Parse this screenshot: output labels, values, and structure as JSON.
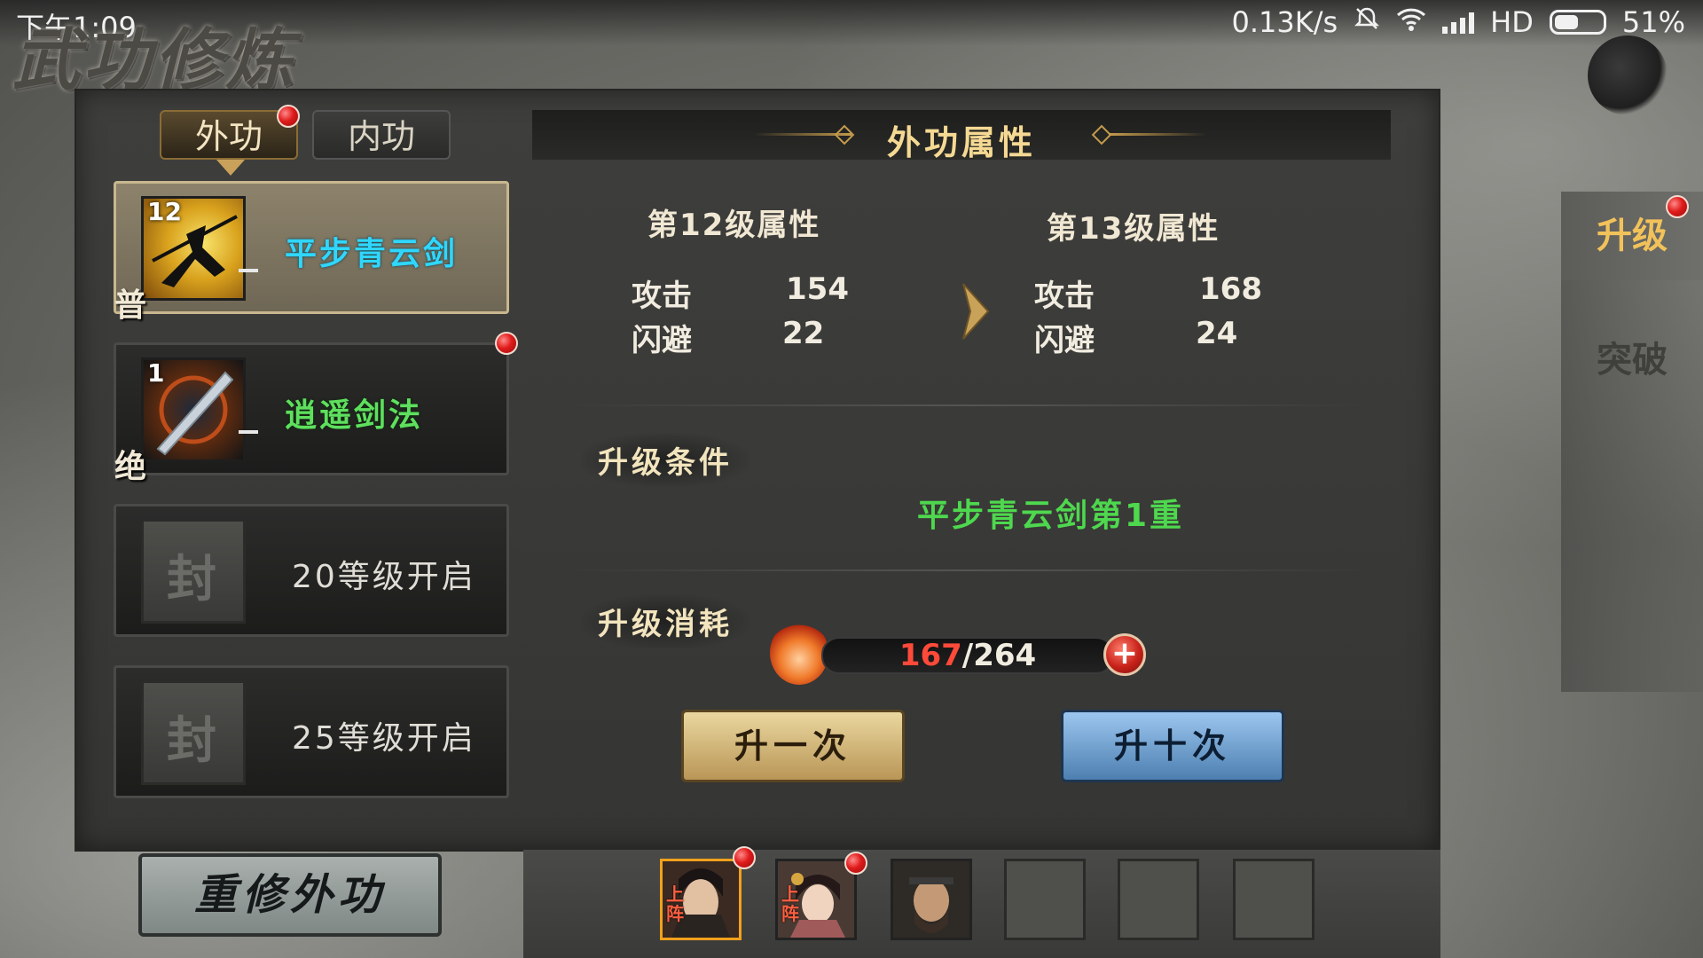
{
  "status_bar": {
    "time": "下午1:09",
    "network_speed": "0.13K/s",
    "network_type": "HD",
    "battery_percent": "51%"
  },
  "page_title": "武功修炼",
  "tabs": [
    {
      "label": "外功",
      "active": true,
      "badge": true
    },
    {
      "label": "内功",
      "active": false,
      "badge": false
    }
  ],
  "skills": [
    {
      "level": "12",
      "grade": "普",
      "name": "平步青云剑",
      "state": "selected",
      "badge": false
    },
    {
      "level": "1",
      "grade": "绝",
      "name": "逍遥剑法",
      "state": "normal",
      "badge": true
    },
    {
      "lock_char": "封",
      "name": "20等级开启",
      "state": "locked"
    },
    {
      "lock_char": "封",
      "name": "25等级开启",
      "state": "locked"
    }
  ],
  "panel": {
    "title": "外功属性",
    "current": {
      "heading": "第12级属性",
      "stats": [
        {
          "label": "攻击",
          "value": "154"
        },
        {
          "label": "闪避",
          "value": "22"
        }
      ]
    },
    "next": {
      "heading": "第13级属性",
      "stats": [
        {
          "label": "攻击",
          "value": "168"
        },
        {
          "label": "闪避",
          "value": "24"
        }
      ]
    },
    "condition_label": "升级条件",
    "condition_text": "平步青云剑第1重",
    "cost_label": "升级消耗",
    "cost_current": "167",
    "cost_total": "/264",
    "btn_once": "升一次",
    "btn_ten": "升十次"
  },
  "side_tabs": [
    {
      "label": "升级",
      "active": true,
      "badge": true
    },
    {
      "label": "突破",
      "active": false,
      "badge": false
    }
  ],
  "rebuild_button": "重修外功",
  "team": {
    "onstage_label": "上阵",
    "slots": [
      {
        "type": "hero-male",
        "onstage": true,
        "badge": true
      },
      {
        "type": "hero-female",
        "onstage": true,
        "badge": true
      },
      {
        "type": "hero-elder",
        "onstage": false,
        "badge": false
      },
      {
        "type": "empty"
      },
      {
        "type": "empty"
      },
      {
        "type": "empty"
      }
    ]
  },
  "colors": {
    "accent_gold": "#f5d993",
    "skill_cyan": "#2fd7ff",
    "skill_green": "#5ee05e",
    "cost_red": "#ff4a3a"
  }
}
